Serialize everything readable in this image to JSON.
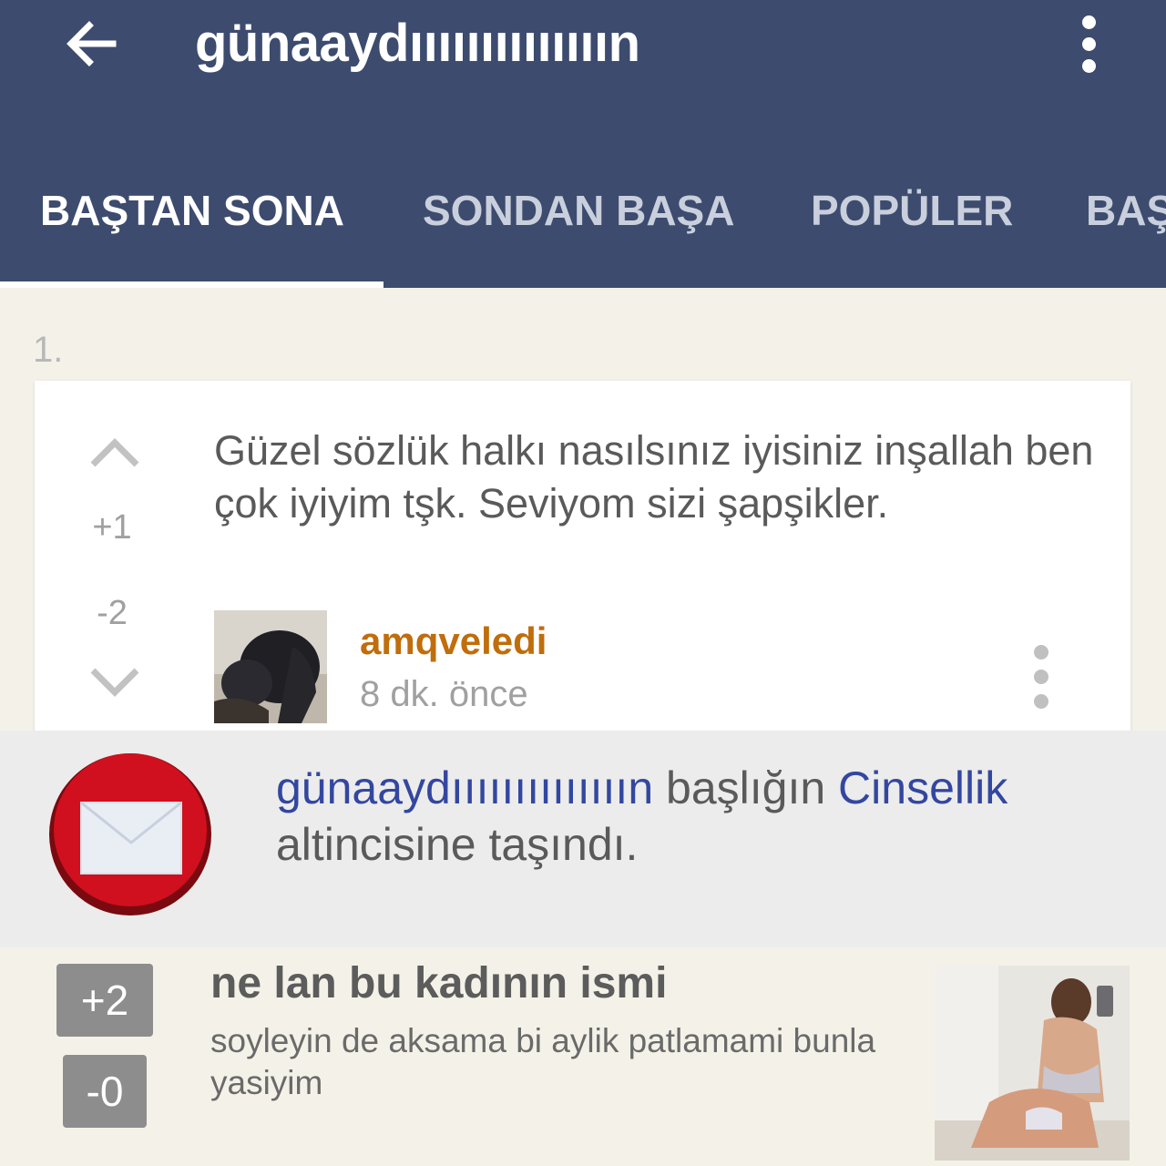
{
  "header": {
    "title": "günaaydıııııııııııııın",
    "back_icon": "arrow-left-icon",
    "menu_icon": "more-vert-icon",
    "background": "#3c4b6e"
  },
  "tabs": [
    {
      "label": "BAŞTAN SONA",
      "active": true
    },
    {
      "label": "SONDAN BAŞA",
      "active": false
    },
    {
      "label": "POPÜLER",
      "active": false
    },
    {
      "label": "BAŞ",
      "active": false
    }
  ],
  "entry": {
    "number": "1.",
    "text": "Güzel sözlük halkı nasılsınız iyisiniz inşallah ben çok iyiyim tşk. Seviyom sizi şapşikler.",
    "upvotes": "+1",
    "downvotes": "-2",
    "author": "amqveledi",
    "time": "8 dk. önce",
    "author_color": "#c06d0c"
  },
  "notification": {
    "topic": "günaaydıııııııııııııın",
    "middle": " başlığın ",
    "channel": "Cinsellik",
    "line2": "altincisine taşındı.",
    "icon": "envelope-icon",
    "badge_color": "#d0101e"
  },
  "suggestion": {
    "plus": "+2",
    "minus": "-0",
    "title": "ne lan bu kadının ismi",
    "text": "soyleyin de aksama bi aylik patlamami bunla yasiyim"
  }
}
